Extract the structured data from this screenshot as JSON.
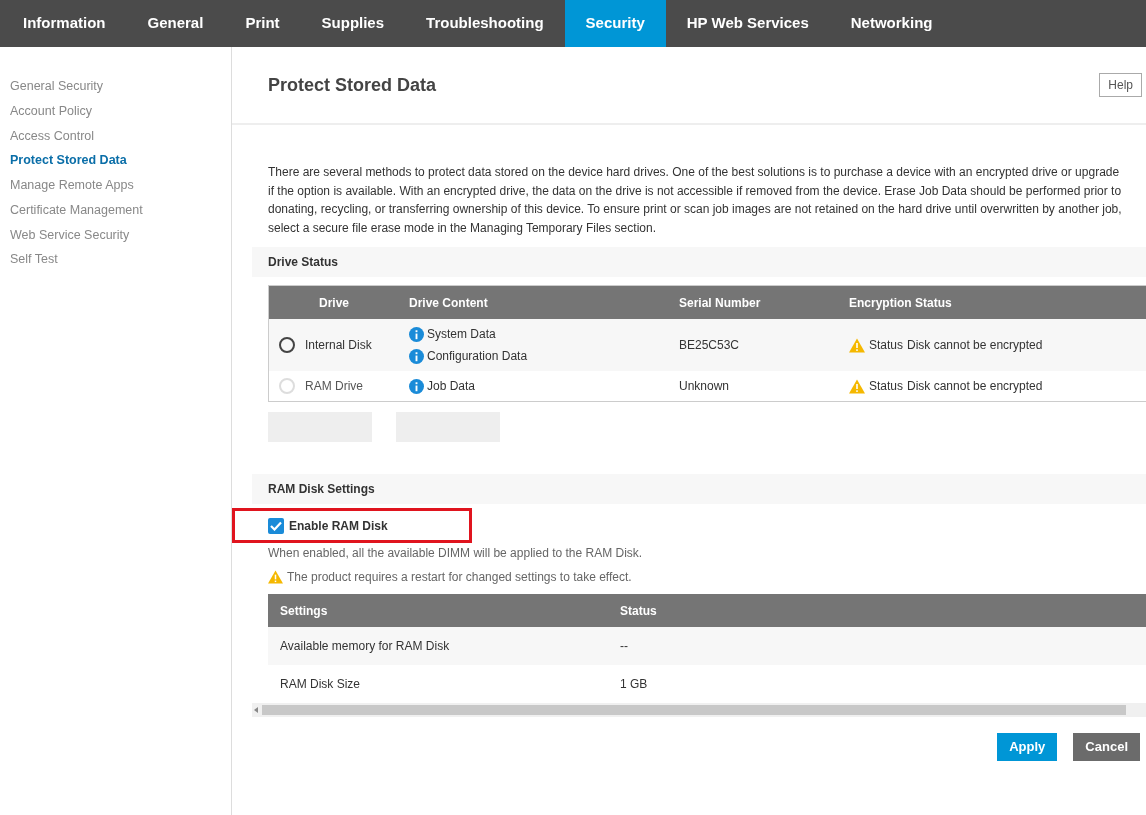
{
  "nav_tabs": [
    {
      "label": "Information",
      "selected": false
    },
    {
      "label": "General",
      "selected": false
    },
    {
      "label": "Print",
      "selected": false
    },
    {
      "label": "Supplies",
      "selected": false
    },
    {
      "label": "Troubleshooting",
      "selected": false
    },
    {
      "label": "Security",
      "selected": true
    },
    {
      "label": "HP Web Services",
      "selected": false
    },
    {
      "label": "Networking",
      "selected": false
    }
  ],
  "sidebar": {
    "items": [
      {
        "label": "General Security",
        "selected": false
      },
      {
        "label": "Account Policy",
        "selected": false
      },
      {
        "label": "Access Control",
        "selected": false
      },
      {
        "label": "Protect Stored Data",
        "selected": true
      },
      {
        "label": "Manage Remote Apps",
        "selected": false
      },
      {
        "label": "Certificate Management",
        "selected": false
      },
      {
        "label": "Web Service Security",
        "selected": false
      },
      {
        "label": "Self Test",
        "selected": false
      }
    ]
  },
  "page": {
    "title": "Protect Stored Data",
    "help_button": "Help",
    "description": "There are several methods to protect data stored on the device hard drives. One of the best solutions is to purchase a device with an encrypted drive or upgrade if the option is available. With an encrypted drive, the data on the drive is not accessible if removed from the device. Erase Job Data should be performed prior to donating, recycling, or transferring ownership of this device. To ensure print or scan job images are not retained on the hard drive until overwritten by another job, select a secure file erase mode in the Managing Temporary Files section."
  },
  "drive_status": {
    "heading": "Drive Status",
    "columns": [
      "Drive",
      "Drive Content",
      "Serial Number",
      "Encryption Status"
    ],
    "rows": [
      {
        "selected": false,
        "disabled": false,
        "drive": "Internal Disk",
        "content": [
          "System Data",
          "Configuration Data"
        ],
        "serial": "BE25C53C",
        "status_label": "Status",
        "status": "Disk cannot be encrypted"
      },
      {
        "selected": false,
        "disabled": true,
        "drive": "RAM Drive",
        "content": [
          "Job Data"
        ],
        "serial": "Unknown",
        "status_label": "Status",
        "status": "Disk cannot be encrypted"
      }
    ],
    "buttons": [
      {
        "disabled": true
      },
      {
        "disabled": true
      }
    ]
  },
  "ram_disk": {
    "heading": "RAM Disk Settings",
    "enable": {
      "label": "Enable RAM Disk",
      "checked": true,
      "highlighted": true
    },
    "note": "When enabled, all the available DIMM will be applied to the RAM Disk.",
    "warning": "The product requires a restart for changed settings to take effect.",
    "columns": [
      "Settings",
      "Status"
    ],
    "rows": [
      [
        "Available memory for RAM Disk",
        "--"
      ],
      [
        "RAM Disk Size",
        "1 GB"
      ]
    ]
  },
  "actions": [
    {
      "label": "Apply",
      "kind": "primary"
    },
    {
      "label": "Cancel",
      "kind": "secondary"
    }
  ]
}
